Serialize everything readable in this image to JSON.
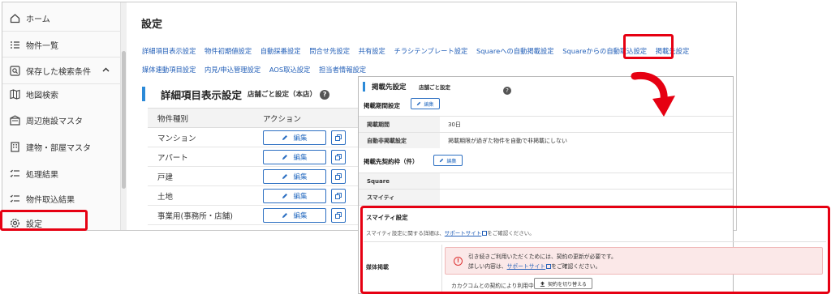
{
  "sidebar": {
    "items": [
      {
        "label": "ホーム",
        "icon": "home-icon"
      },
      {
        "label": "物件一覧",
        "icon": "list-icon"
      },
      {
        "label": "保存した検索条件",
        "icon": "saved-search-icon"
      },
      {
        "label": "地図検索",
        "icon": "map-icon"
      },
      {
        "label": "周辺施設マスタ",
        "icon": "facility-icon"
      },
      {
        "label": "建物・部屋マスタ",
        "icon": "building-icon"
      },
      {
        "label": "処理結果",
        "icon": "checklist-icon"
      },
      {
        "label": "物件取込結果",
        "icon": "checklist-icon"
      },
      {
        "label": "設定",
        "icon": "gear-icon"
      }
    ]
  },
  "main": {
    "title": "設定",
    "tabs": [
      "詳細項目表示設定",
      "物件初期値設定",
      "自動採番設定",
      "問合せ先設定",
      "共有設定",
      "チラシテンプレート設定",
      "Squareへの自動掲載設定",
      "Squareからの自動取込設定",
      "掲載先設定",
      "媒体連動項目設定",
      "内見/申込管理設定",
      "AOS取込設定",
      "担当者情報設定"
    ],
    "section_title": "詳細項目表示設定",
    "section_badge": "店舗ごと設定（本店）",
    "table": {
      "headers": [
        "物件種別",
        "アクション"
      ],
      "rows": [
        "マンション",
        "アパート",
        "戸建",
        "土地",
        "事業用(事務所・店舗)"
      ],
      "edit_label": "編集"
    }
  },
  "panel": {
    "title": "掲載先設定",
    "badge": "店舗ごと設定",
    "period_section": "掲載期間設定",
    "edit_label": "編集",
    "period_rows": [
      {
        "label": "掲載期間",
        "value": "30日"
      },
      {
        "label": "自動非掲載設定",
        "value": "掲載期限が過ぎた物件を自動で非掲載にしない"
      }
    ],
    "quota_section": "掲載先契約枠（件）",
    "quota_rows": [
      "Square",
      "スマイティ"
    ],
    "smt": {
      "title": "スマイティ設定",
      "desc_before": "スマイティ設定に関する詳細は、",
      "desc_link": "サポートサイト",
      "desc_after": "をご確認ください。",
      "media_label": "媒体掲載",
      "alert_line1": "引き続きご利用いただくためには、契約の更新が必要です。",
      "alert_line2_before": "詳しい内容は、",
      "alert_link": "サポートサイト",
      "alert_line2_after": "をご確認ください。",
      "contract_text": "カカクコムとの契約により利用中",
      "switch_label": "契約を切り替える"
    }
  },
  "colors": {
    "highlight": "#e60012",
    "link": "#2460b8",
    "accent": "#2c8ad8"
  }
}
